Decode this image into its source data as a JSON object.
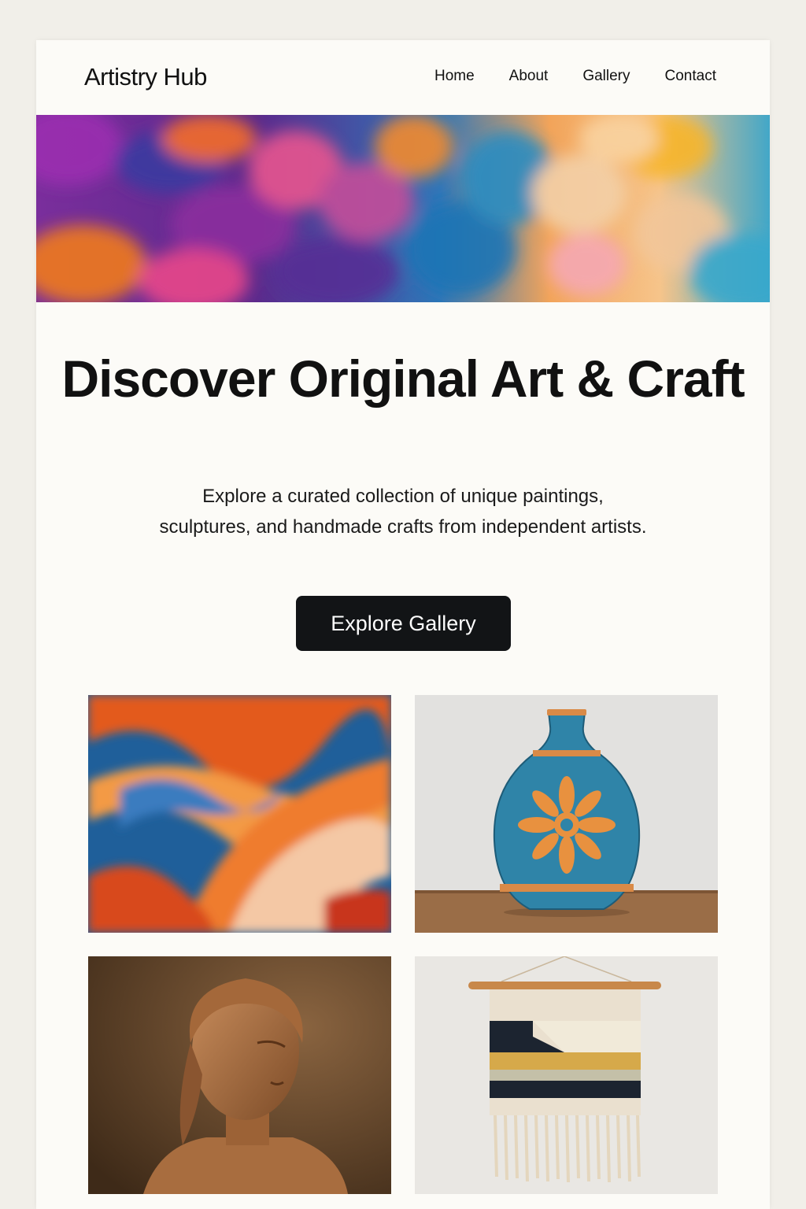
{
  "header": {
    "logo": "Artistry Hub",
    "nav": [
      "Home",
      "About",
      "Gallery",
      "Contact"
    ]
  },
  "banner": {
    "icon": "abstract-painting-banner"
  },
  "hero": {
    "title": "Discover Original Art & Craft",
    "subtitle": "Explore a curated collection of unique  paintings, sculptures, and handmade crafts from independent artists.",
    "cta_label": "Explore Gallery"
  },
  "gallery": {
    "items": [
      {
        "icon": "abstract-painting-image"
      },
      {
        "icon": "ceramic-vase-image"
      },
      {
        "icon": "sculpture-bust-image"
      },
      {
        "icon": "woven-wall-hanging-image"
      }
    ]
  },
  "colors": {
    "background": "#f1efe9",
    "page": "#fcfbf7",
    "button": "#121416",
    "text": "#111111"
  }
}
